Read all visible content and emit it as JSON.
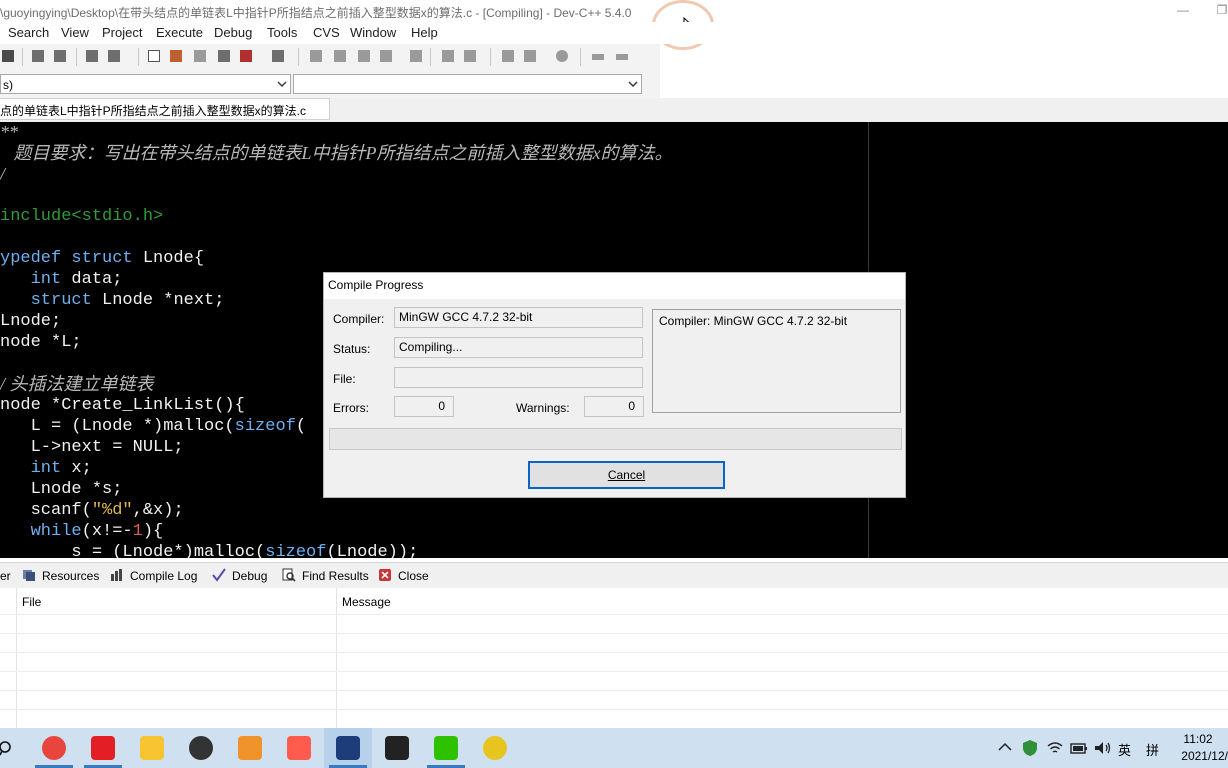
{
  "window": {
    "title": "\\guoyingying\\Desktop\\在带头结点的单链表L中指针P所指结点之前插入整型数据x的算法.c - [Compiling] - Dev-C++ 5.4.0"
  },
  "menu": [
    "Search",
    "View",
    "Project",
    "Execute",
    "Debug",
    "Tools",
    "CVS",
    "Window",
    "Help"
  ],
  "combos": {
    "left_value": "s)",
    "right_value": ""
  },
  "editor_tab": {
    "label": "点的单链表L中指针P所指结点之前插入整型数据x的算法.c"
  },
  "code": [
    [
      {
        "t": "**",
        "c": "c-comment"
      }
    ],
    [
      {
        "t": "   题目要求：写出在带头结点的单链表L中指针P所指结点之前插入整型数据x的算法。",
        "c": "c-comment"
      }
    ],
    [
      {
        "t": "/",
        "c": "c-comment"
      }
    ],
    [
      {
        "t": "",
        "c": "c-id"
      }
    ],
    [
      {
        "t": "include<stdio.h>",
        "c": "c-pre"
      }
    ],
    [
      {
        "t": "",
        "c": "c-id"
      }
    ],
    [
      {
        "t": "ypedef struct ",
        "c": "c-kw"
      },
      {
        "t": "Lnode{",
        "c": "c-id"
      }
    ],
    [
      {
        "t": "   int ",
        "c": "c-kw"
      },
      {
        "t": "data;",
        "c": "c-id"
      }
    ],
    [
      {
        "t": "   struct ",
        "c": "c-kw"
      },
      {
        "t": "Lnode *next;",
        "c": "c-id"
      }
    ],
    [
      {
        "t": "Lnode;",
        "c": "c-id"
      }
    ],
    [
      {
        "t": "node *L;",
        "c": "c-id"
      }
    ],
    [
      {
        "t": "",
        "c": "c-id"
      }
    ],
    [
      {
        "t": "/ 头插法建立单链表",
        "c": "c-comment"
      }
    ],
    [
      {
        "t": "node *Create_LinkList(){",
        "c": "c-id"
      }
    ],
    [
      {
        "t": "   L = (Lnode *)malloc(",
        "c": "c-id"
      },
      {
        "t": "sizeof",
        "c": "c-kw"
      },
      {
        "t": "(",
        "c": "c-id"
      }
    ],
    [
      {
        "t": "   L->next = NULL;",
        "c": "c-id"
      }
    ],
    [
      {
        "t": "   int ",
        "c": "c-kw"
      },
      {
        "t": "x;",
        "c": "c-id"
      }
    ],
    [
      {
        "t": "   Lnode *s;",
        "c": "c-id"
      }
    ],
    [
      {
        "t": "   scanf(",
        "c": "c-id"
      },
      {
        "t": "\"%d\"",
        "c": "c-str"
      },
      {
        "t": ",&x);",
        "c": "c-id"
      }
    ],
    [
      {
        "t": "   while",
        "c": "c-kw"
      },
      {
        "t": "(x!=-",
        "c": "c-id"
      },
      {
        "t": "1",
        "c": "c-num"
      },
      {
        "t": "){",
        "c": "c-id"
      }
    ],
    [
      {
        "t": "       s = (Lnode*)malloc(",
        "c": "c-id"
      },
      {
        "t": "sizeof",
        "c": "c-kw"
      },
      {
        "t": "(Lnode));",
        "c": "c-id"
      }
    ]
  ],
  "bottom_tabs": {
    "first_partial": "er",
    "resources": "Resources",
    "compile_log": "Compile Log",
    "debug": "Debug",
    "find_results": "Find Results",
    "close": "Close"
  },
  "message_table": {
    "col_file": "File",
    "col_message": "Message"
  },
  "dialog": {
    "title": "Compile Progress",
    "compiler_label": "Compiler:",
    "compiler_value": "MinGW GCC 4.7.2 32-bit",
    "status_label": "Status:",
    "status_value": "Compiling...",
    "file_label": "File:",
    "file_value": "",
    "errors_label": "Errors:",
    "errors_value": "0",
    "warnings_label": "Warnings:",
    "warnings_value": "0",
    "log_text": "Compiler: MinGW GCC 4.7.2 32-bit",
    "cancel_label": "Cancel",
    "progress": 0
  },
  "taskbar": {
    "time": "11:02",
    "date": "2021/12/",
    "ime_lang": "英",
    "ime_mode": "拼",
    "apps": [
      {
        "name": "chrome",
        "color": "#e8453c"
      },
      {
        "name": "youdao",
        "color": "#e31e24"
      },
      {
        "name": "sticky-notes",
        "color": "#f6c531"
      },
      {
        "name": "app-dots",
        "color": "#333333"
      },
      {
        "name": "clock-app",
        "color": "#f0932b"
      },
      {
        "name": "calendar-app",
        "color": "#ff5c4d"
      },
      {
        "name": "devcpp",
        "color": "#1c3c7a"
      },
      {
        "name": "typora",
        "color": "#222222"
      },
      {
        "name": "wechat",
        "color": "#2dc100"
      },
      {
        "name": "music",
        "color": "#e7c520"
      }
    ]
  }
}
